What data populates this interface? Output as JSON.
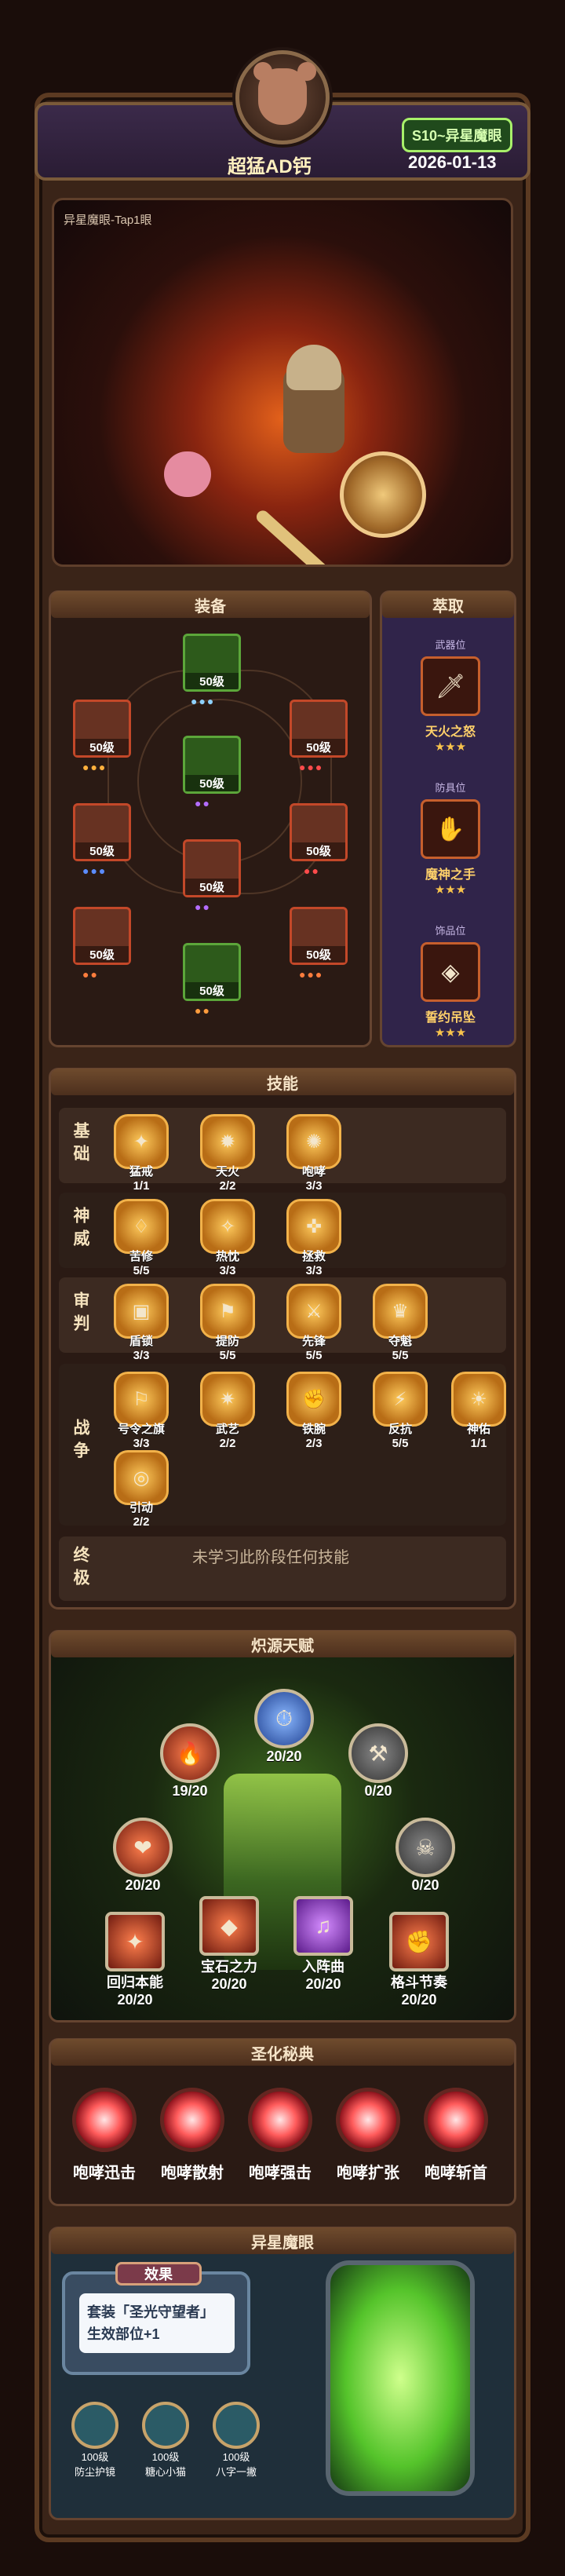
{
  "profile": {
    "nickname": "超猛AD钙",
    "season": "S10~异星魔眼",
    "date": "2026-01-13"
  },
  "hero": {
    "stage_title": "异星魔眼-Tap1眼"
  },
  "equipment": {
    "title": "装备",
    "slots": [
      {
        "level": "50级",
        "gems": "●●●"
      },
      {
        "level": "50级",
        "gems": "●●●"
      },
      {
        "level": "50级",
        "gems": "●●●"
      },
      {
        "level": "50级",
        "gems": "●●"
      },
      {
        "level": "50级",
        "gems": "●●●"
      },
      {
        "level": "50级",
        "gems": "●●"
      },
      {
        "level": "50级",
        "gems": "●●"
      },
      {
        "level": "50级",
        "gems": "●●"
      },
      {
        "level": "50级",
        "gems": "●●●"
      },
      {
        "level": "50级",
        "gems": "●●"
      },
      {
        "level": "50级",
        "gems": "●●●"
      },
      {
        "level": "50级",
        "gems": "●●"
      }
    ]
  },
  "loot": {
    "title": "萃取",
    "items": [
      {
        "category": "武器位",
        "name": "天火之怒",
        "stars": "★★★"
      },
      {
        "category": "防具位",
        "name": "魔神之手",
        "stars": "★★★"
      },
      {
        "category": "饰品位",
        "name": "誓约吊坠",
        "stars": "★★★"
      }
    ]
  },
  "skills": {
    "title": "技能",
    "basic_label": "基础",
    "basic": [
      {
        "name": "猛戒",
        "level": "1/1"
      },
      {
        "name": "天火",
        "level": "2/2"
      },
      {
        "name": "咆哮",
        "level": "3/3"
      }
    ],
    "divine_label": "神威",
    "divine": [
      {
        "name": "苦修",
        "level": "5/5"
      },
      {
        "name": "热忱",
        "level": "3/3"
      },
      {
        "name": "拯救",
        "level": "3/3"
      }
    ],
    "judge_label": "审判",
    "judge": [
      {
        "name": "盾锁",
        "level": "3/3"
      },
      {
        "name": "提防",
        "level": "5/5"
      },
      {
        "name": "先锋",
        "level": "5/5"
      },
      {
        "name": "夺魁",
        "level": "5/5"
      }
    ],
    "war_label": "战争",
    "war": [
      {
        "name": "号令之旗",
        "level": "3/3"
      },
      {
        "name": "武艺",
        "level": "2/2"
      },
      {
        "name": "铁腕",
        "level": "2/3"
      },
      {
        "name": "反抗",
        "level": "5/5"
      },
      {
        "name": "神佑",
        "level": "1/1"
      },
      {
        "name": "引动",
        "level": "2/2"
      }
    ],
    "ultimate_label": "终极",
    "ultimate_note": "未学习此阶段任何技能"
  },
  "talent": {
    "title": "炽源天赋",
    "nodes": [
      {
        "value": "19/20"
      },
      {
        "value": "20/20"
      },
      {
        "value": "0/20"
      },
      {
        "value": "20/20"
      },
      {
        "value": "0/20"
      }
    ],
    "bottom": [
      {
        "name": "回归本能",
        "value": "20/20"
      },
      {
        "name": "宝石之力",
        "value": "20/20"
      },
      {
        "name": "入阵曲",
        "value": "20/20"
      },
      {
        "name": "格斗节奏",
        "value": "20/20"
      }
    ]
  },
  "holy": {
    "title": "圣化秘典",
    "items": [
      "咆哮迅击",
      "咆哮散射",
      "咆哮强击",
      "咆哮扩张",
      "咆哮斩首"
    ]
  },
  "alien": {
    "title": "异星魔眼",
    "effect_badge": "效果",
    "effect_text_1": "套装「圣光守望者」",
    "effect_text_2": "生效部位+1",
    "avatars": [
      {
        "level": "100级",
        "name": "防尘护镜"
      },
      {
        "level": "100级",
        "name": "糖心小猫"
      },
      {
        "level": "100级",
        "name": "八字一撇"
      }
    ]
  }
}
